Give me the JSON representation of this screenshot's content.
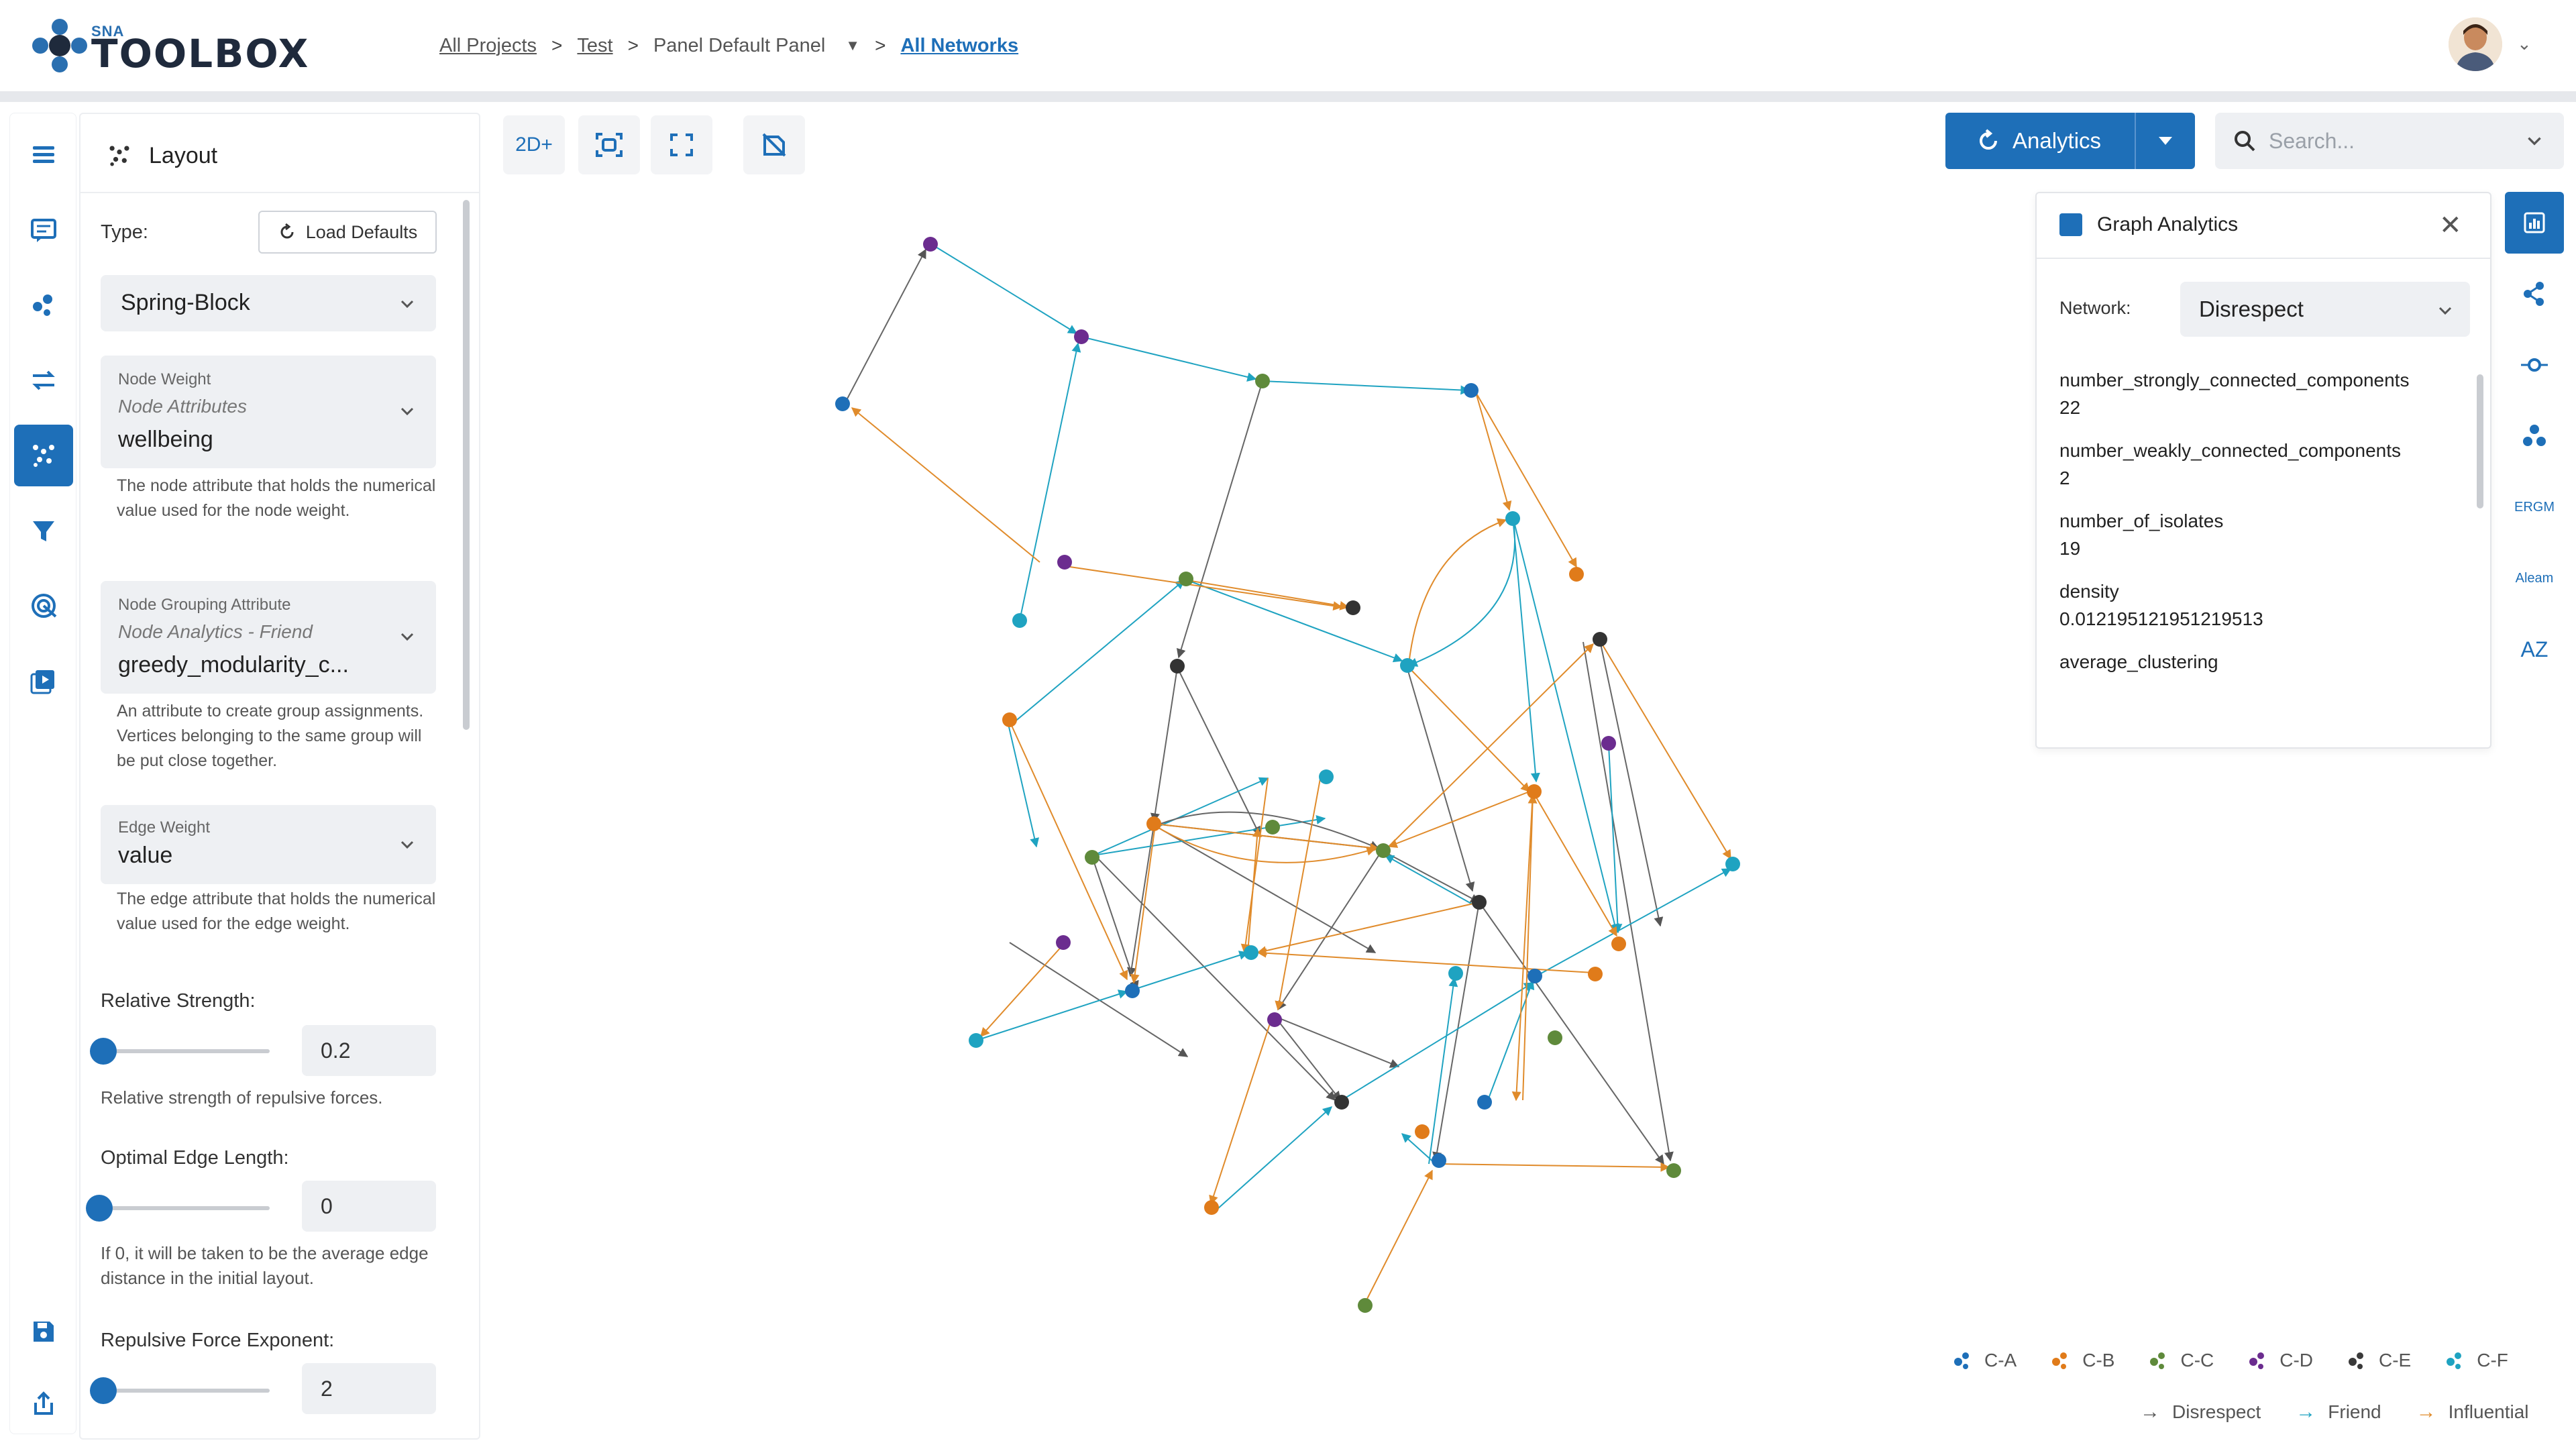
{
  "logo": {
    "sna": "SNA",
    "name": "TOOLBOX"
  },
  "breadcrumb": {
    "items": [
      "All Projects",
      "Test",
      "Panel Default Panel"
    ],
    "separator": ">",
    "current": "All Networks"
  },
  "layout_panel": {
    "title": "Layout",
    "type_label": "Type:",
    "load_defaults_label": "Load Defaults",
    "type_value": "Spring-Block",
    "node_weight": {
      "label": "Node Weight",
      "group": "Node Attributes",
      "value": "wellbeing",
      "help": "The node attribute that holds the numerical value used for the node weight."
    },
    "node_grouping": {
      "label": "Node Grouping Attribute",
      "group": "Node Analytics - Friend",
      "value": "greedy_modularity_c...",
      "help": "An attribute to create group assignments. Vertices belonging to the same group will be put close together."
    },
    "edge_weight": {
      "label": "Edge Weight",
      "value": "value",
      "help": "The edge attribute that holds the numerical value used for the edge weight."
    },
    "relative_strength": {
      "label": "Relative Strength:",
      "value": "0.2",
      "help": "Relative strength of repulsive forces."
    },
    "optimal_edge_length": {
      "label": "Optimal Edge Length:",
      "value": "0",
      "help": "If 0, it will be taken to be the average edge distance in the initial layout."
    },
    "repulsive_force_exponent": {
      "label": "Repulsive Force Exponent:",
      "value": "2"
    }
  },
  "toolbar": {
    "mode_label": "2D+",
    "analytics_label": "Analytics",
    "search_placeholder": "Search..."
  },
  "graph_analytics": {
    "title": "Graph Analytics",
    "network_label": "Network:",
    "network_value": "Disrespect",
    "metrics": [
      {
        "name": "number_strongly_connected_components",
        "value": "22"
      },
      {
        "name": "number_weakly_connected_components",
        "value": "2"
      },
      {
        "name": "number_of_isolates",
        "value": "19"
      },
      {
        "name": "density",
        "value": "0.012195121951219513"
      },
      {
        "name": "average_clustering",
        "value": ""
      }
    ]
  },
  "right_rail": {
    "ergm": "ERGM",
    "aleam": "Aleam",
    "az": "AZ"
  },
  "legend": {
    "groups": [
      {
        "label": "C-A",
        "color": "#1e6fb8"
      },
      {
        "label": "C-B",
        "color": "#e07b1a"
      },
      {
        "label": "C-C",
        "color": "#5f8a3b"
      },
      {
        "label": "C-D",
        "color": "#6b2c8f"
      },
      {
        "label": "C-E",
        "color": "#3a3a3a"
      },
      {
        "label": "C-F",
        "color": "#1fa3c1"
      }
    ],
    "networks": [
      {
        "label": "Disrespect",
        "color": "#555555"
      },
      {
        "label": "Friend",
        "color": "#1fa3c1"
      },
      {
        "label": "Influential",
        "color": "#e08b2b"
      }
    ]
  },
  "colors": {
    "accent": "#1e6fb8"
  }
}
